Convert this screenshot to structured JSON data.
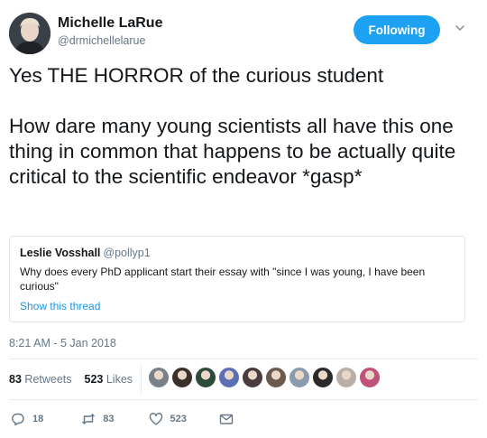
{
  "author": {
    "name": "Michelle LaRue",
    "handle": "@drmichellelarue"
  },
  "follow_label": "Following",
  "tweet_text": "Yes THE HORROR of the curious student\n\nHow dare many young scientists all have this one thing in common that happens to be actually quite critical to the scientific endeavor *gasp*",
  "quoted_tweet": {
    "author_name": "Leslie Vosshall",
    "author_handle": "@pollyp1",
    "text": "Why does every PhD applicant start their essay with \"since I was young, I have been curious\"",
    "link_label": "Show this thread"
  },
  "timestamp": "8:21 AM - 5 Jan 2018",
  "stats": {
    "retweets_count": "83",
    "retweets_label": "Retweets",
    "likes_count": "523",
    "likes_label": "Likes"
  },
  "liker_colors": [
    "#7a8088",
    "#3b2f2a",
    "#2e4a3a",
    "#5b6fb5",
    "#4a3b3f",
    "#6b5a4e",
    "#8a9bb0",
    "#2a2a2a",
    "#b8b0a8",
    "#c0527a"
  ],
  "actions": {
    "reply_count": "18",
    "retweet_count": "83",
    "like_count": "523"
  },
  "colors": {
    "accent": "#1da1f2",
    "text_primary": "#14171a",
    "text_secondary": "#657786"
  }
}
